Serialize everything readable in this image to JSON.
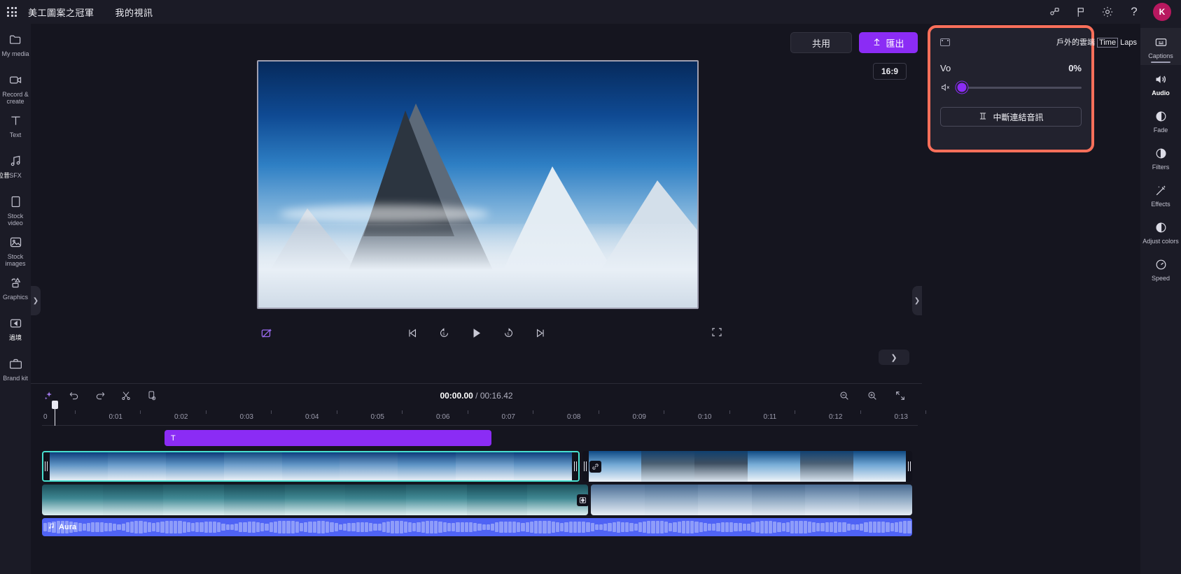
{
  "topbar": {
    "waffle_icon": "app-grid-icon",
    "brand": "美工圖案之冠軍",
    "project_name": "我的視訊",
    "icons": [
      {
        "name": "share-people-icon",
        "glyph": "share"
      },
      {
        "name": "flag-icon",
        "glyph": "flag"
      },
      {
        "name": "gear-icon",
        "glyph": "gear"
      },
      {
        "name": "help-icon",
        "glyph": "?"
      }
    ],
    "avatar_initial": "K",
    "avatar_color": "#b8185f"
  },
  "sidebar": {
    "items": [
      {
        "label": "My media",
        "icon": "folder-icon",
        "cjk": ""
      },
      {
        "label": "Record & create",
        "icon": "camera-icon",
        "cjk": ""
      },
      {
        "label": "Text",
        "icon": "text-icon",
        "cjk": ""
      },
      {
        "label": "SFX",
        "icon": "music-note-icon",
        "cjk": "拉昔"
      },
      {
        "label": "Stock video",
        "icon": "film-icon",
        "cjk": ""
      },
      {
        "label": "Stock images",
        "icon": "image-icon",
        "cjk": ""
      },
      {
        "label": "Graphics",
        "icon": "shapes-icon",
        "cjk": ""
      },
      {
        "label": "",
        "icon": "transitions-icon",
        "cjk": "過境"
      },
      {
        "label": "Brand kit",
        "icon": "brandkit-icon",
        "cjk": ""
      }
    ],
    "collapse_icon": "chevron-right-icon"
  },
  "stage": {
    "share_label": "共用",
    "export_label": "匯出",
    "export_icon": "upload-arrow-icon",
    "export_color": "#8b2cf5",
    "aspect_ratio": "16:9",
    "magic_icon": "magic-wand-icon",
    "transport": [
      {
        "name": "skip-start-button",
        "icon": "skip-previous-icon"
      },
      {
        "name": "rewind-5-button",
        "icon": "rewind-5s-icon"
      },
      {
        "name": "play-button",
        "icon": "play-icon"
      },
      {
        "name": "forward-5-button",
        "icon": "forward-5s-icon"
      },
      {
        "name": "skip-end-button",
        "icon": "skip-next-icon"
      }
    ],
    "fullscreen_icon": "fullscreen-icon",
    "panel_chevron_icon": "chevron-down-icon",
    "right_collapse_icon": "chevron-right-icon"
  },
  "properties_panel": {
    "highlight_color": "#fb6f5a",
    "clip_icon": "film-clip-icon",
    "clip_title_prefix": "戶外的雲端",
    "clip_title_boxed": "Time",
    "clip_title_suffix": "Laps",
    "volume_label": "Vo",
    "volume_value": "0%",
    "mute_icon": "speaker-mute-icon",
    "slider_position_percent": 0,
    "detach_label": "中斷連結音訊",
    "detach_icon": "detach-audio-icon"
  },
  "right_rail": {
    "items": [
      {
        "label": "Captions",
        "icon": "captions-icon",
        "state": "partial"
      },
      {
        "label": "Audio",
        "icon": "speaker-icon",
        "state": "active"
      },
      {
        "label": "Fade",
        "icon": "fade-icon",
        "state": "normal"
      },
      {
        "label": "Filters",
        "icon": "filters-icon",
        "state": "normal"
      },
      {
        "label": "Effects",
        "icon": "effects-wand-icon",
        "state": "normal"
      },
      {
        "label": "Adjust colors",
        "icon": "adjust-colors-icon",
        "state": "normal"
      },
      {
        "label": "Speed",
        "icon": "speed-gauge-icon",
        "state": "normal"
      }
    ]
  },
  "timeline": {
    "toolbar_icons": [
      {
        "name": "magic-timeline-icon",
        "glyph": "sparkle"
      },
      {
        "name": "undo-icon",
        "glyph": "undo"
      },
      {
        "name": "redo-icon",
        "glyph": "redo"
      },
      {
        "name": "split-scissors-icon",
        "glyph": "scissors"
      },
      {
        "name": "duplicate-icon",
        "glyph": "duplicate"
      }
    ],
    "current_time": "00:00.00",
    "total_time": " / 00:16.42",
    "zoom_out_icon": "zoom-out-icon",
    "zoom_in_icon": "zoom-in-icon",
    "fit_icon": "fit-timeline-icon",
    "ruler_ticks": [
      "0",
      "0:01",
      "0:02",
      "0:03",
      "0:04",
      "0:05",
      "0:06",
      "0:07",
      "0:08",
      "0:09",
      "0:10",
      "0:11",
      "0:12",
      "0:13"
    ],
    "text_clip_label": "T",
    "audio_clip_name": "Aura",
    "audio_clip_icon": "music-note-icon",
    "overlay_badge_icon": "transition-badge-icon",
    "clip2_badge_icon": "link-badge-icon"
  }
}
